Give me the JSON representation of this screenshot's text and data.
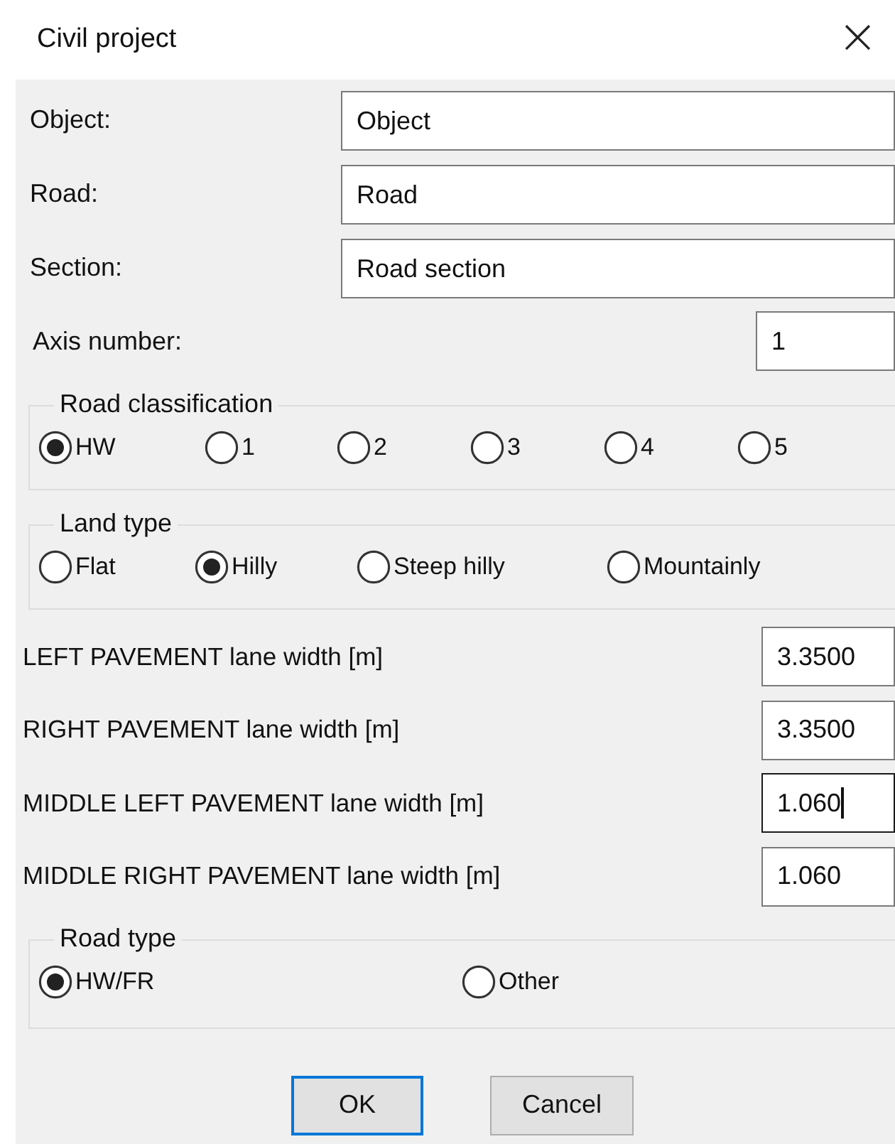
{
  "window": {
    "title": "Civil project",
    "close": "×"
  },
  "fields": [
    {
      "label": "Object:",
      "value": "Object"
    },
    {
      "label": "Road:",
      "value": "Road"
    },
    {
      "label": "Section:",
      "value": "Road section"
    }
  ],
  "axis": {
    "label": "Axis number:",
    "value": "1"
  },
  "groups": [
    {
      "title": "Road classification",
      "options": [
        {
          "label": "HW",
          "selected": true
        },
        {
          "label": "1",
          "selected": false
        },
        {
          "label": "2",
          "selected": false
        },
        {
          "label": "3",
          "selected": false
        },
        {
          "label": "4",
          "selected": false
        },
        {
          "label": "5",
          "selected": false
        }
      ]
    },
    {
      "title": "Land type",
      "options": [
        {
          "label": "Flat",
          "selected": false
        },
        {
          "label": "Hilly",
          "selected": true
        },
        {
          "label": "Steep hilly",
          "selected": false
        },
        {
          "label": "Mountainly",
          "selected": false
        }
      ]
    }
  ],
  "widths": [
    {
      "label": "LEFT PAVEMENT lane width [m]",
      "value": "3.3500",
      "focused": false
    },
    {
      "label": "RIGHT PAVEMENT lane width [m]",
      "value": "3.3500",
      "focused": false
    },
    {
      "label": "MIDDLE LEFT PAVEMENT lane width [m]",
      "value": "1.060",
      "focused": true
    },
    {
      "label": "MIDDLE RIGHT PAVEMENT lane width [m]",
      "value": "1.060",
      "focused": false
    }
  ],
  "road_type": {
    "title": "Road type",
    "options": [
      {
        "label": "HW/FR",
        "selected": true
      },
      {
        "label": "Other",
        "selected": false
      }
    ]
  },
  "buttons": [
    {
      "label": "OK",
      "default": true
    },
    {
      "label": "Cancel",
      "default": false
    }
  ]
}
